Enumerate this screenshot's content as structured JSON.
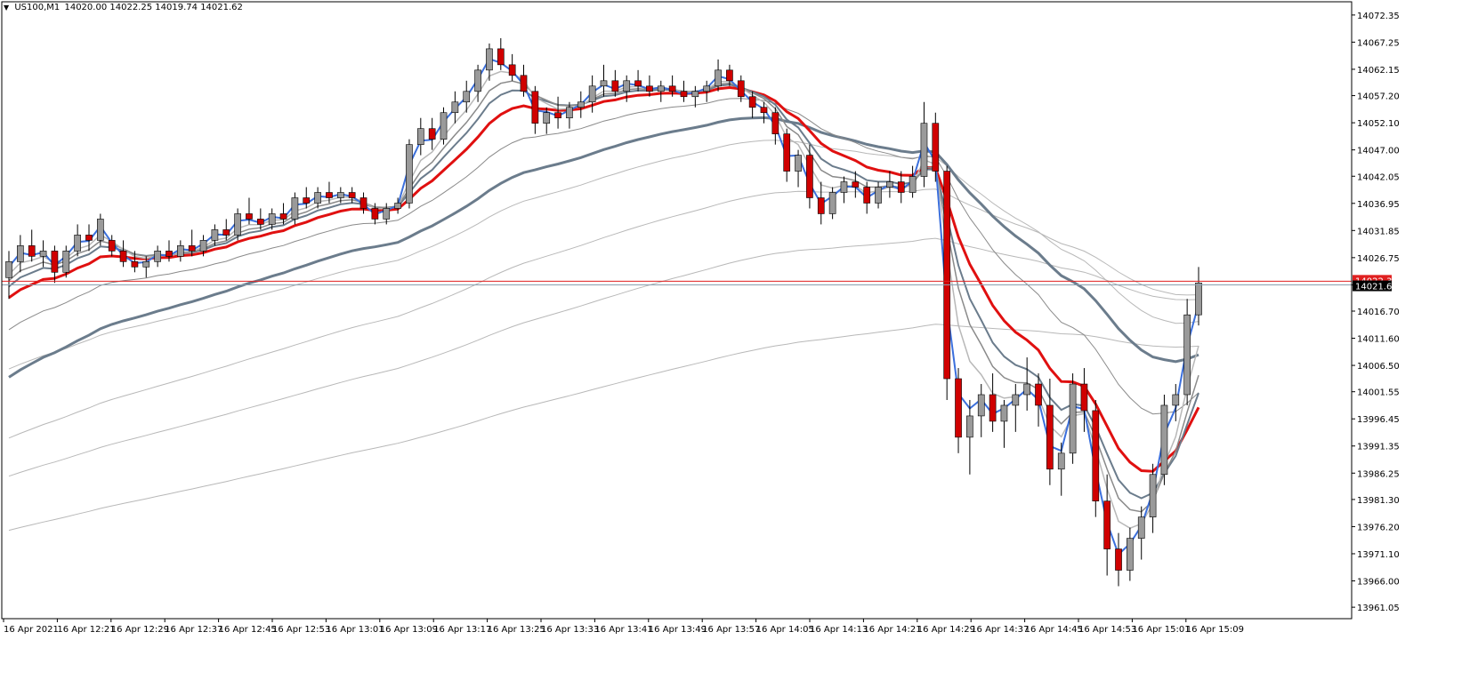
{
  "header": {
    "symbol": "US100,M1",
    "open": "14020.00",
    "high": "14022.25",
    "low": "14019.74",
    "close": "14021.62"
  },
  "price_axis": {
    "labels": [
      "14072.35",
      "14067.25",
      "14062.15",
      "14057.20",
      "14052.10",
      "14047.00",
      "14042.05",
      "14036.95",
      "14031.85",
      "14026.75",
      "14021.62",
      "14016.70",
      "14011.60",
      "14006.50",
      "14001.55",
      "13996.45",
      "13991.35",
      "13986.25",
      "13981.30",
      "13976.20",
      "13971.10",
      "13966.00",
      "13961.05"
    ],
    "current_price_label": "14021.62",
    "ask_label": "14022.32"
  },
  "time_axis": {
    "labels": [
      "16 Apr 2021",
      "16 Apr 12:21",
      "16 Apr 12:29",
      "16 Apr 12:37",
      "16 Apr 12:45",
      "16 Apr 12:53",
      "16 Apr 13:01",
      "16 Apr 13:09",
      "16 Apr 13:17",
      "16 Apr 13:25",
      "16 Apr 13:33",
      "16 Apr 13:41",
      "16 Apr 13:49",
      "16 Apr 13:57",
      "16 Apr 14:05",
      "16 Apr 14:13",
      "16 Apr 14:21",
      "16 Apr 14:29",
      "16 Apr 14:37",
      "16 Apr 14:45",
      "16 Apr 14:53",
      "16 Apr 15:01",
      "16 Apr 15:09"
    ]
  },
  "colors": {
    "background": "#ffffff",
    "bull_candle": "#9a9a9a",
    "bear_candle": "#d00000",
    "wick": "#000000",
    "ma_blue": "#3b6fdc",
    "ma_red": "#e01010",
    "ma_dark": "#6b7c8c",
    "ma_grey": "#8a8a8a",
    "ma_light": "#b8b8b8",
    "bid_line": "#8aa0b0",
    "ask_line": "#e02020"
  },
  "chart_data": {
    "type": "candlestick",
    "symbol": "US100",
    "timeframe": "M1",
    "y_range": [
      13959.4,
      14073.5
    ],
    "bid": 14021.62,
    "ask": 14022.32,
    "candles": [
      [
        14023,
        14028,
        14019,
        14026
      ],
      [
        14026,
        14031,
        14024,
        14029
      ],
      [
        14029,
        14032,
        14026,
        14027
      ],
      [
        14027,
        14030,
        14025,
        14028
      ],
      [
        14028,
        14029,
        14022,
        14024
      ],
      [
        14024,
        14029,
        14023,
        14028
      ],
      [
        14028,
        14033,
        14027,
        14031
      ],
      [
        14031,
        14033,
        14028,
        14030
      ],
      [
        14030,
        14035,
        14029,
        14034
      ],
      [
        14030,
        14031,
        14027,
        14028
      ],
      [
        14028,
        14030,
        14025,
        14026
      ],
      [
        14026,
        14028,
        14024,
        14025
      ],
      [
        14025,
        14027,
        14023,
        14026
      ],
      [
        14026,
        14029,
        14025,
        14028
      ],
      [
        14028,
        14030,
        14026,
        14027
      ],
      [
        14027,
        14030,
        14026,
        14029
      ],
      [
        14029,
        14032,
        14027,
        14028
      ],
      [
        14028,
        14031,
        14027,
        14030
      ],
      [
        14030,
        14033,
        14029,
        14032
      ],
      [
        14032,
        14034,
        14030,
        14031
      ],
      [
        14031,
        14036,
        14030,
        14035
      ],
      [
        14035,
        14038,
        14033,
        14034
      ],
      [
        14034,
        14036,
        14032,
        14033
      ],
      [
        14033,
        14036,
        14032,
        14035
      ],
      [
        14035,
        14037,
        14033,
        14034
      ],
      [
        14034,
        14039,
        14033,
        14038
      ],
      [
        14038,
        14040,
        14036,
        14037
      ],
      [
        14037,
        14040,
        14036,
        14039
      ],
      [
        14039,
        14041,
        14037,
        14038
      ],
      [
        14038,
        14040,
        14037,
        14039
      ],
      [
        14039,
        14040,
        14037,
        14038
      ],
      [
        14038,
        14039,
        14035,
        14036
      ],
      [
        14036,
        14037,
        14033,
        14034
      ],
      [
        14034,
        14037,
        14033,
        14036
      ],
      [
        14036,
        14038,
        14035,
        14037
      ],
      [
        14037,
        14049,
        14036,
        14048
      ],
      [
        14048,
        14053,
        14046,
        14051
      ],
      [
        14051,
        14053,
        14047,
        14049
      ],
      [
        14049,
        14055,
        14048,
        14054
      ],
      [
        14054,
        14058,
        14052,
        14056
      ],
      [
        14056,
        14060,
        14054,
        14058
      ],
      [
        14058,
        14063,
        14056,
        14062
      ],
      [
        14062,
        14067,
        14060,
        14066
      ],
      [
        14066,
        14068,
        14062,
        14063
      ],
      [
        14063,
        14065,
        14060,
        14061
      ],
      [
        14061,
        14063,
        14057,
        14058
      ],
      [
        14058,
        14059,
        14050,
        14052
      ],
      [
        14052,
        14055,
        14050,
        14054
      ],
      [
        14054,
        14057,
        14051,
        14053
      ],
      [
        14053,
        14056,
        14051,
        14055
      ],
      [
        14055,
        14058,
        14053,
        14056
      ],
      [
        14056,
        14061,
        14054,
        14059
      ],
      [
        14059,
        14063,
        14057,
        14060
      ],
      [
        14060,
        14062,
        14057,
        14058
      ],
      [
        14058,
        14061,
        14056,
        14060
      ],
      [
        14060,
        14062,
        14058,
        14059
      ],
      [
        14059,
        14061,
        14057,
        14058
      ],
      [
        14058,
        14060,
        14056,
        14059
      ],
      [
        14059,
        14061,
        14057,
        14058
      ],
      [
        14058,
        14060,
        14056,
        14057
      ],
      [
        14057,
        14059,
        14055,
        14058
      ],
      [
        14058,
        14060,
        14056,
        14059
      ],
      [
        14059,
        14064,
        14058,
        14062
      ],
      [
        14062,
        14063,
        14059,
        14060
      ],
      [
        14060,
        14061,
        14056,
        14057
      ],
      [
        14057,
        14058,
        14053,
        14055
      ],
      [
        14055,
        14056,
        14052,
        14054
      ],
      [
        14054,
        14055,
        14048,
        14050
      ],
      [
        14050,
        14051,
        14041,
        14043
      ],
      [
        14043,
        14047,
        14040,
        14046
      ],
      [
        14046,
        14048,
        14036,
        14038
      ],
      [
        14038,
        14041,
        14033,
        14035
      ],
      [
        14035,
        14040,
        14034,
        14039
      ],
      [
        14039,
        14042,
        14037,
        14041
      ],
      [
        14041,
        14043,
        14038,
        14040
      ],
      [
        14040,
        14041,
        14035,
        14037
      ],
      [
        14037,
        14041,
        14036,
        14040
      ],
      [
        14040,
        14043,
        14038,
        14041
      ],
      [
        14041,
        14043,
        14037,
        14039
      ],
      [
        14039,
        14044,
        14038,
        14042
      ],
      [
        14042,
        14056,
        14040,
        14052
      ],
      [
        14052,
        14054,
        14041,
        14043
      ],
      [
        14043,
        14044,
        14000,
        14004
      ],
      [
        14004,
        14006,
        13990,
        13993
      ],
      [
        13993,
        14000,
        13986,
        13997
      ],
      [
        13997,
        14003,
        13993,
        14001
      ],
      [
        14001,
        14005,
        13994,
        13996
      ],
      [
        13996,
        14000,
        13991,
        13999
      ],
      [
        13999,
        14003,
        13994,
        14001
      ],
      [
        14001,
        14008,
        13998,
        14003
      ],
      [
        14003,
        14005,
        13995,
        13999
      ],
      [
        13999,
        14004,
        13984,
        13987
      ],
      [
        13987,
        13992,
        13982,
        13990
      ],
      [
        13990,
        14005,
        13988,
        14003
      ],
      [
        14003,
        14006,
        13994,
        13998
      ],
      [
        13998,
        14000,
        13978,
        13981
      ],
      [
        13981,
        13986,
        13967,
        13972
      ],
      [
        13972,
        13975,
        13965,
        13968
      ],
      [
        13968,
        13976,
        13966,
        13974
      ],
      [
        13974,
        13980,
        13970,
        13978
      ],
      [
        13978,
        13988,
        13975,
        13986
      ],
      [
        13986,
        14001,
        13984,
        13999
      ],
      [
        13999,
        14003,
        13996,
        14001
      ],
      [
        14001,
        14019,
        13999,
        14016
      ],
      [
        14016,
        14025,
        14014,
        14022
      ]
    ]
  }
}
